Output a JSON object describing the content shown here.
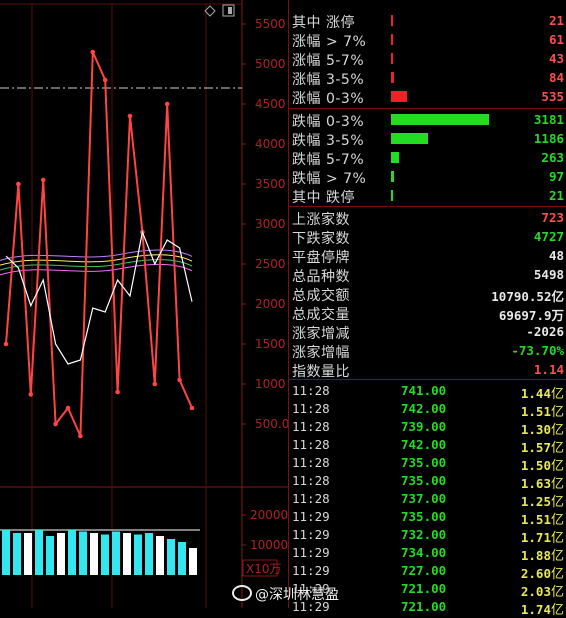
{
  "chart": {
    "y_ticks": [
      "5500",
      "5000",
      "4500",
      "4000",
      "3500",
      "3000",
      "2500",
      "2000",
      "1500",
      "1000",
      "500.00"
    ],
    "vol_ticks": [
      "20000",
      "10000"
    ],
    "vol_unit": "X10万",
    "icons": [
      "diamond-icon",
      "square-icon"
    ]
  },
  "chart_data": {
    "type": "line",
    "ylim": [
      0,
      5800
    ],
    "grid": true,
    "series": [
      {
        "color": "#ff4444",
        "values": [
          1500,
          3500,
          870,
          3550,
          500,
          700,
          350,
          5150,
          4800,
          900,
          4350,
          2900,
          1000,
          4500,
          1050,
          700
        ]
      },
      {
        "color": "#ffffff",
        "values": [
          2600,
          2450,
          1980,
          2300,
          1500,
          1250,
          1300,
          1950,
          1900,
          2300,
          2100,
          2900,
          2500,
          2800,
          2700,
          2030
        ]
      }
    ],
    "volume": [
      15000,
      14000,
      14000,
      15000,
      13000,
      14000,
      15000,
      14500,
      14000,
      13500,
      14500,
      14000,
      13500,
      14000,
      13000,
      12000,
      11000,
      9000
    ]
  },
  "stats_up": [
    {
      "label": "其中 涨停",
      "value": "21"
    },
    {
      "label": "涨幅 > 7%",
      "value": "61"
    },
    {
      "label": "涨幅 5-7%",
      "value": "43"
    },
    {
      "label": "涨幅 3-5%",
      "value": "84"
    },
    {
      "label": "涨幅 0-3%",
      "value": "535"
    }
  ],
  "stats_down": [
    {
      "label": "跌幅 0-3%",
      "value": "3181"
    },
    {
      "label": "跌幅 3-5%",
      "value": "1186"
    },
    {
      "label": "跌幅 5-7%",
      "value": "263"
    },
    {
      "label": "跌幅 > 7%",
      "value": "97"
    },
    {
      "label": "其中 跌停",
      "value": "21"
    }
  ],
  "summary": [
    {
      "label": "上涨家数",
      "value": "723",
      "color": "red"
    },
    {
      "label": "下跌家数",
      "value": "4727",
      "color": "green"
    },
    {
      "label": "平盘停牌",
      "value": "48",
      "color": "white"
    },
    {
      "label": "总品种数",
      "value": "5498",
      "color": "white"
    },
    {
      "label": "总成交额",
      "value": "10790.52亿",
      "color": "white"
    },
    {
      "label": "总成交量",
      "value": "69697.9万",
      "color": "white"
    },
    {
      "label": "涨家增减",
      "value": "-2026",
      "color": "white"
    },
    {
      "label": "涨家增幅",
      "value": "-73.70%",
      "color": "green"
    },
    {
      "label": "指数量比",
      "value": "1.14",
      "color": "red"
    }
  ],
  "ticks": [
    {
      "time": "11:28",
      "price": "741.00",
      "amount": "1.44",
      "unit": "亿"
    },
    {
      "time": "11:28",
      "price": "742.00",
      "amount": "1.51",
      "unit": "亿"
    },
    {
      "time": "11:28",
      "price": "739.00",
      "amount": "1.30",
      "unit": "亿"
    },
    {
      "time": "11:28",
      "price": "742.00",
      "amount": "1.57",
      "unit": "亿"
    },
    {
      "time": "11:28",
      "price": "735.00",
      "amount": "1.50",
      "unit": "亿"
    },
    {
      "time": "11:28",
      "price": "735.00",
      "amount": "1.63",
      "unit": "亿"
    },
    {
      "time": "11:28",
      "price": "737.00",
      "amount": "1.25",
      "unit": "亿"
    },
    {
      "time": "11:29",
      "price": "735.00",
      "amount": "1.51",
      "unit": "亿"
    },
    {
      "time": "11:29",
      "price": "732.00",
      "amount": "1.71",
      "unit": "亿"
    },
    {
      "time": "11:29",
      "price": "734.00",
      "amount": "1.88",
      "unit": "亿"
    },
    {
      "time": "11:29",
      "price": "727.00",
      "amount": "2.60",
      "unit": "亿"
    },
    {
      "time": "11:29",
      "price": "721.00",
      "amount": "2.03",
      "unit": "亿"
    },
    {
      "time": "11:29",
      "price": "721.00",
      "amount": "1.74",
      "unit": "亿"
    }
  ],
  "watermark": "@深圳林慧盈"
}
